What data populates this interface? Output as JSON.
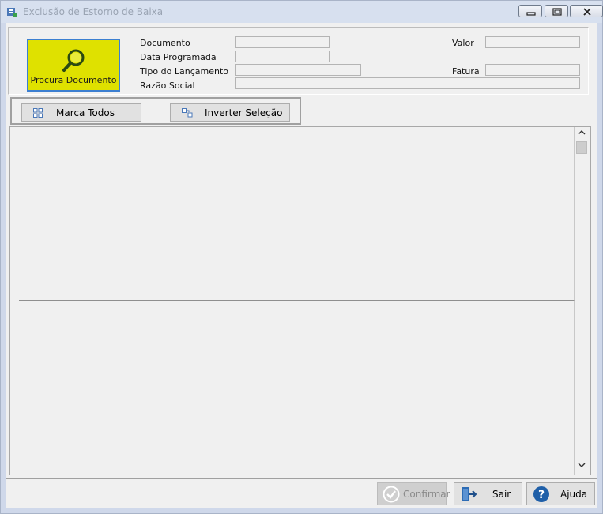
{
  "window": {
    "title": "Exclusão de Estorno de Baixa"
  },
  "search_button": {
    "label": "Procura Documento",
    "icon": "magnifier-icon"
  },
  "fields": {
    "documento": {
      "label": "Documento",
      "value": ""
    },
    "data_programada": {
      "label": "Data Programada",
      "value": ""
    },
    "tipo_lancamento": {
      "label": "Tipo do Lançamento",
      "value": ""
    },
    "razao_social": {
      "label": "Razão Social",
      "value": ""
    },
    "valor": {
      "label": "Valor",
      "value": ""
    },
    "fatura": {
      "label": "Fatura",
      "value": ""
    }
  },
  "toolbar": {
    "marca_todos": "Marca Todos",
    "inverter_selecao": "Inverter Seleção"
  },
  "footer": {
    "confirmar": "Confirmar",
    "sair": "Sair",
    "ajuda": "Ajuda"
  },
  "colors": {
    "search_button_bg": "#dfe100",
    "search_button_border": "#3c7fd1",
    "help_icon": "#1f5fa8"
  }
}
